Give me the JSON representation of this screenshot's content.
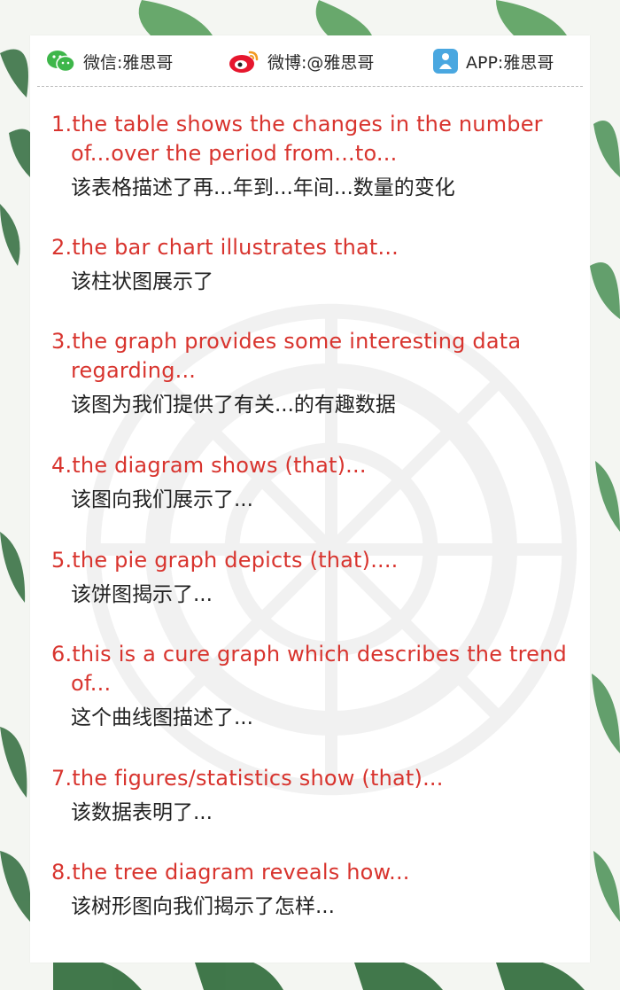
{
  "header": {
    "wechat": {
      "icon": "wechat-icon",
      "label": "微信:雅思哥",
      "color": "#3eb64a"
    },
    "weibo": {
      "icon": "weibo-icon",
      "label": "微博:@雅思哥",
      "color": "#e6162d"
    },
    "app": {
      "icon": "app-icon",
      "label": "APP:雅思哥",
      "color": "#49a7e0"
    }
  },
  "colors": {
    "english_text": "#d8342e",
    "chinese_text": "#222222"
  },
  "phrases": [
    {
      "en": "1.the table shows the changes in the number of...over the period from...to...",
      "cn": "该表格描述了再...年到...年间...数量的变化"
    },
    {
      "en": "2.the bar chart illustrates that...",
      "cn": "该柱状图展示了"
    },
    {
      "en": "3.the graph provides some interesting data regarding...",
      "cn": "该图为我们提供了有关...的有趣数据"
    },
    {
      "en": "4.the diagram shows (that)...",
      "cn": "该图向我们展示了..."
    },
    {
      "en": "5.the pie graph depicts (that)....",
      "cn": "该饼图揭示了..."
    },
    {
      "en": "6.this is a cure graph which describes the trend of...",
      "cn": "这个曲线图描述了..."
    },
    {
      "en": "7.the figures/statistics show (that)...",
      "cn": "该数据表明了..."
    },
    {
      "en": "8.the tree diagram reveals how...",
      "cn": "该树形图向我们揭示了怎样..."
    }
  ]
}
